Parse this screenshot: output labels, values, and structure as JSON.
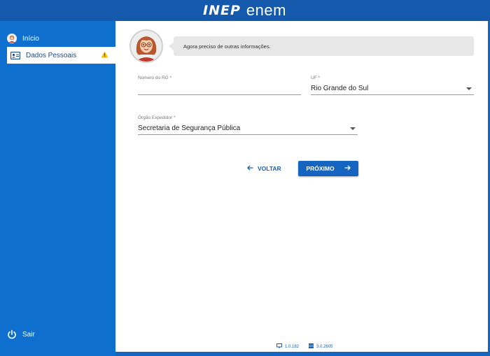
{
  "header": {
    "logo_left": "INEP",
    "logo_right": "enem"
  },
  "sidebar": {
    "items": [
      {
        "label": "Início"
      },
      {
        "label": "Dados Pessoais"
      },
      {
        "label": "Sair"
      }
    ]
  },
  "assistant": {
    "message": "Agora preciso de outras informações."
  },
  "form": {
    "rg": {
      "label": "Número do RG *",
      "value": ""
    },
    "uf": {
      "label": "UF *",
      "value": "Rio Grande do Sul"
    },
    "orgao": {
      "label": "Órgão Expedidor *",
      "value": "Secretaria de Segurança Pública"
    }
  },
  "actions": {
    "back_label": "VOLTAR",
    "next_label": "PRÓXIMO"
  },
  "footer": {
    "client_version": "1.0.182",
    "server_version": "3.0.2605"
  },
  "colors": {
    "topbar": "#1559ad",
    "sidebar": "#0f6fce",
    "primary_button": "#1565c0",
    "warning": "#f5c000"
  }
}
